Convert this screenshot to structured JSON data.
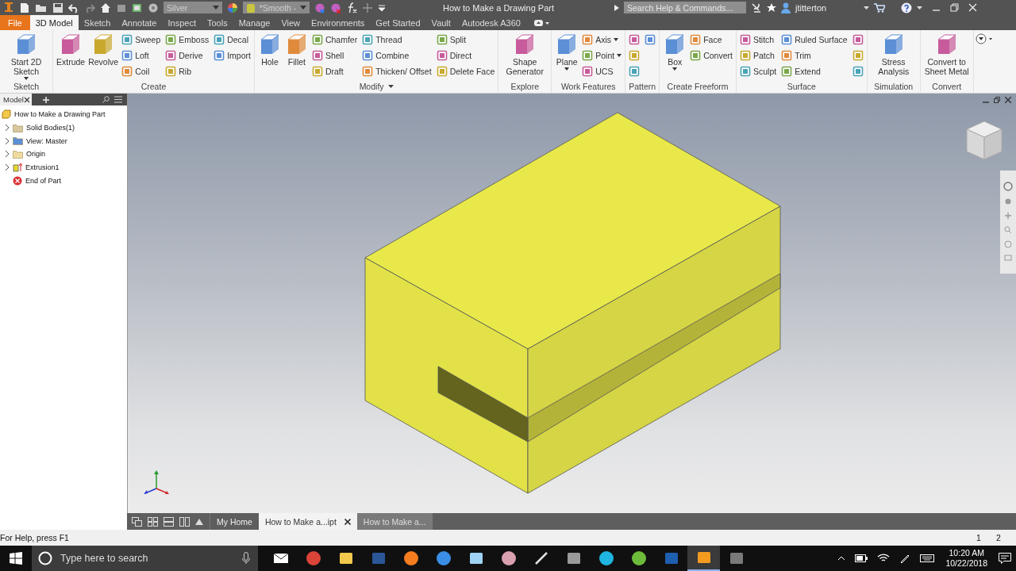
{
  "quick_access": {
    "appearance": "Silver",
    "visual_style": "*Smooth -"
  },
  "window": {
    "title": "How to Make a Drawing Part"
  },
  "help_search": {
    "placeholder": "Search Help & Commands..."
  },
  "user": {
    "name": "jtitterton"
  },
  "ribbon_tabs": [
    {
      "label": "File",
      "kind": "file",
      "selected": false
    },
    {
      "label": "3D Model",
      "kind": "tab",
      "selected": true
    },
    {
      "label": "Sketch",
      "kind": "tab",
      "selected": false
    },
    {
      "label": "Annotate",
      "kind": "tab",
      "selected": false
    },
    {
      "label": "Inspect",
      "kind": "tab",
      "selected": false
    },
    {
      "label": "Tools",
      "kind": "tab",
      "selected": false
    },
    {
      "label": "Manage",
      "kind": "tab",
      "selected": false
    },
    {
      "label": "View",
      "kind": "tab",
      "selected": false
    },
    {
      "label": "Environments",
      "kind": "tab",
      "selected": false
    },
    {
      "label": "Get Started",
      "kind": "tab",
      "selected": false
    },
    {
      "label": "Vault",
      "kind": "tab",
      "selected": false
    },
    {
      "label": "Autodesk A360",
      "kind": "tab",
      "selected": false
    }
  ],
  "ribbon_panels": [
    {
      "title": "Sketch",
      "tools": [
        {
          "label": "Start 2D Sketch",
          "kind": "large",
          "dropdown": true
        }
      ]
    },
    {
      "title": "Create",
      "tools": [
        {
          "label": "Extrude",
          "kind": "large"
        },
        {
          "label": "Revolve",
          "kind": "large"
        },
        {
          "label": "Sweep",
          "kind": "small"
        },
        {
          "label": "Loft",
          "kind": "small"
        },
        {
          "label": "Coil",
          "kind": "small"
        },
        {
          "label": "Emboss",
          "kind": "small"
        },
        {
          "label": "Derive",
          "kind": "small"
        },
        {
          "label": "Rib",
          "kind": "small"
        },
        {
          "label": "Decal",
          "kind": "small"
        },
        {
          "label": "Import",
          "kind": "small"
        }
      ]
    },
    {
      "title": "Modify",
      "menu": true,
      "tools": [
        {
          "label": "Hole",
          "kind": "large"
        },
        {
          "label": "Fillet",
          "kind": "large"
        },
        {
          "label": "Chamfer",
          "kind": "small"
        },
        {
          "label": "Shell",
          "kind": "small"
        },
        {
          "label": "Draft",
          "kind": "small"
        },
        {
          "label": "Thread",
          "kind": "small"
        },
        {
          "label": "Combine",
          "kind": "small"
        },
        {
          "label": "Thicken/ Offset",
          "kind": "small"
        },
        {
          "label": "Split",
          "kind": "small"
        },
        {
          "label": "Direct",
          "kind": "small"
        },
        {
          "label": "Delete Face",
          "kind": "small"
        }
      ]
    },
    {
      "title": "Explore",
      "tools": [
        {
          "label": "Shape Generator",
          "kind": "large"
        }
      ]
    },
    {
      "title": "Work Features",
      "tools": [
        {
          "label": "Plane",
          "kind": "large",
          "dropdown": true
        },
        {
          "label": "Axis",
          "kind": "small",
          "dropdown": true
        },
        {
          "label": "Point",
          "kind": "small",
          "dropdown": true
        },
        {
          "label": "UCS",
          "kind": "small"
        }
      ]
    },
    {
      "title": "Pattern",
      "tools": [
        {
          "kind": "icon"
        },
        {
          "kind": "icon"
        },
        {
          "kind": "icon"
        },
        {
          "kind": "icon"
        }
      ]
    },
    {
      "title": "Create Freeform",
      "tools": [
        {
          "label": "Box",
          "kind": "large",
          "dropdown": true
        },
        {
          "label": "Face",
          "kind": "small"
        },
        {
          "label": "Convert",
          "kind": "small"
        }
      ]
    },
    {
      "title": "Surface",
      "tools": [
        {
          "label": "Stitch",
          "kind": "small"
        },
        {
          "label": "Patch",
          "kind": "small"
        },
        {
          "label": "Sculpt",
          "kind": "small"
        },
        {
          "label": "Ruled Surface",
          "kind": "small"
        },
        {
          "label": "Trim",
          "kind": "small"
        },
        {
          "label": "Extend",
          "kind": "small"
        },
        {
          "kind": "icon"
        },
        {
          "kind": "icon"
        },
        {
          "kind": "icon"
        }
      ]
    },
    {
      "title": "Simulation",
      "tools": [
        {
          "label": "Stress Analysis",
          "kind": "large"
        }
      ]
    },
    {
      "title": "Convert",
      "tools": [
        {
          "label": "Convert to Sheet Metal",
          "kind": "large"
        }
      ]
    }
  ],
  "browser": {
    "tab": "Model",
    "tree": {
      "label": "How to Make a Drawing Part",
      "kind": "part",
      "children": [
        {
          "label": "Solid Bodies(1)",
          "kind": "bodies",
          "expanded": false
        },
        {
          "label": "View: Master",
          "kind": "view",
          "expanded": false
        },
        {
          "label": "Origin",
          "kind": "folder",
          "expanded": false
        },
        {
          "label": "Extrusion1",
          "kind": "feature",
          "expanded": false
        },
        {
          "label": "End of Part",
          "kind": "end"
        }
      ]
    }
  },
  "document_tabs": [
    {
      "label": "My Home",
      "selected": false,
      "closable": false
    },
    {
      "label": "How to Make a...ipt",
      "selected": true,
      "closable": true
    },
    {
      "label": "How to Make a...",
      "selected": false,
      "closable": false
    }
  ],
  "status_bar": {
    "help": "For Help, press F1",
    "pages": [
      "1",
      "2"
    ]
  },
  "taskbar": {
    "search_placeholder": "Type here to search",
    "time": "10:20 AM",
    "date": "10/22/2018",
    "apps": [
      {
        "kind": "envelope",
        "selected": false
      },
      {
        "kind": "wheel",
        "selected": false
      },
      {
        "kind": "folder",
        "selected": false
      },
      {
        "kind": "page",
        "selected": false
      },
      {
        "kind": "globe",
        "selected": false
      },
      {
        "kind": "disc",
        "selected": false
      },
      {
        "kind": "monitor",
        "selected": false
      },
      {
        "kind": "sphere",
        "selected": false
      },
      {
        "kind": "pen",
        "selected": false
      },
      {
        "kind": "picture",
        "selected": false
      },
      {
        "kind": "swirl",
        "selected": false
      },
      {
        "kind": "ring",
        "selected": false
      },
      {
        "kind": "tile",
        "selected": false
      },
      {
        "kind": "pillar",
        "selected": true
      },
      {
        "kind": "calculator",
        "selected": false
      }
    ]
  }
}
